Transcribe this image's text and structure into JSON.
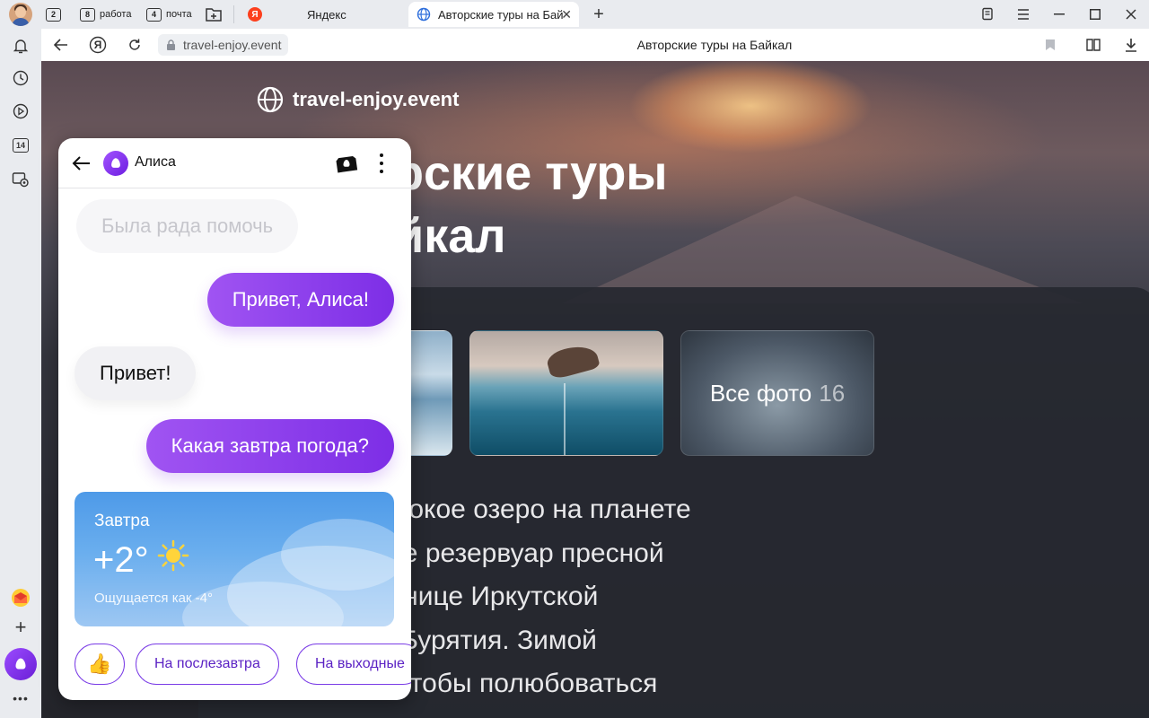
{
  "tabstrip": {
    "groups": [
      {
        "count": "2",
        "label": ""
      },
      {
        "count": "8",
        "label": "работа"
      },
      {
        "count": "4",
        "label": "почта"
      }
    ],
    "tabs": [
      {
        "title": "Яндекс",
        "favicon": "yandex-favicon",
        "active": false
      },
      {
        "title": "Авторские туры на Бай",
        "favicon": "globe-icon",
        "active": true
      }
    ]
  },
  "toolbar": {
    "url": "travel-enjoy.event",
    "page_title": "Авторские туры на Байкал",
    "yandex_button": "Я"
  },
  "sidebar": {
    "badge_count": "14"
  },
  "page": {
    "site_name": "travel-enjoy.event",
    "hero_line1": "рские туры",
    "hero_line2": "йкал",
    "all_photos_label": "Все фото",
    "all_photos_count": "16",
    "description": [
      "– самое глубокое озеро на планете",
      "упный в мире резервуар пресной",
      "дится на границе Иркутской",
      "Республики Бурятия. Зимой",
      "приезжают, чтобы полюбоваться"
    ]
  },
  "alice": {
    "title": "Алиса",
    "messages": [
      {
        "from": "alice",
        "text": "Была рада помочь",
        "faded": true
      },
      {
        "from": "user",
        "text": "Привет, Алиса!"
      },
      {
        "from": "alice",
        "text": "Привет!"
      },
      {
        "from": "user",
        "text": "Какая завтра погода?"
      }
    ],
    "weather": {
      "day": "Завтра",
      "temperature": "+2°",
      "icon": "sun-icon",
      "feels_like": "Ощущается как -4°"
    },
    "suggestions": [
      {
        "label": "👍",
        "icon": "thumbs-up-icon"
      },
      {
        "label": "На послезавтра"
      },
      {
        "label": "На выходные"
      }
    ]
  },
  "colors": {
    "alice_accent": "#7d2ee6",
    "chip_text": "#5b22c4",
    "weather_blue": "#4e9ae8"
  }
}
